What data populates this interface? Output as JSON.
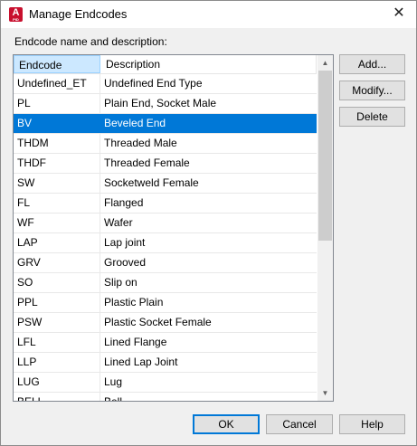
{
  "window": {
    "title": "Manage Endcodes",
    "close_glyph": "✕",
    "app_icon_letter": "A",
    "app_icon_sub": "PID"
  },
  "caption": "Endcode name and description:",
  "table": {
    "headers": {
      "code": "Endcode",
      "description": "Description"
    },
    "rows": [
      {
        "code": "Undefined_ET",
        "description": "Undefined End Type"
      },
      {
        "code": "PL",
        "description": "Plain End, Socket Male"
      },
      {
        "code": "BV",
        "description": "Beveled End"
      },
      {
        "code": "THDM",
        "description": "Threaded Male"
      },
      {
        "code": "THDF",
        "description": "Threaded Female"
      },
      {
        "code": "SW",
        "description": "Socketweld Female"
      },
      {
        "code": "FL",
        "description": "Flanged"
      },
      {
        "code": "WF",
        "description": "Wafer"
      },
      {
        "code": "LAP",
        "description": "Lap joint"
      },
      {
        "code": "GRV",
        "description": "Grooved"
      },
      {
        "code": "SO",
        "description": "Slip on"
      },
      {
        "code": "PPL",
        "description": "Plastic Plain"
      },
      {
        "code": "PSW",
        "description": "Plastic Socket Female"
      },
      {
        "code": "LFL",
        "description": "Lined Flange"
      },
      {
        "code": "LLP",
        "description": "Lined Lap Joint"
      },
      {
        "code": "LUG",
        "description": "Lug"
      },
      {
        "code": "BELL",
        "description": "Bell"
      }
    ],
    "selected_row": 2,
    "scroll_up_glyph": "▲",
    "scroll_down_glyph": "▼"
  },
  "side_buttons": {
    "add": "Add...",
    "modify": "Modify...",
    "delete": "Delete"
  },
  "footer_buttons": {
    "ok": "OK",
    "cancel": "Cancel",
    "help": "Help"
  },
  "colors": {
    "selection": "#0078d7",
    "header_selected": "#cce8ff",
    "icon": "#c8102e"
  }
}
